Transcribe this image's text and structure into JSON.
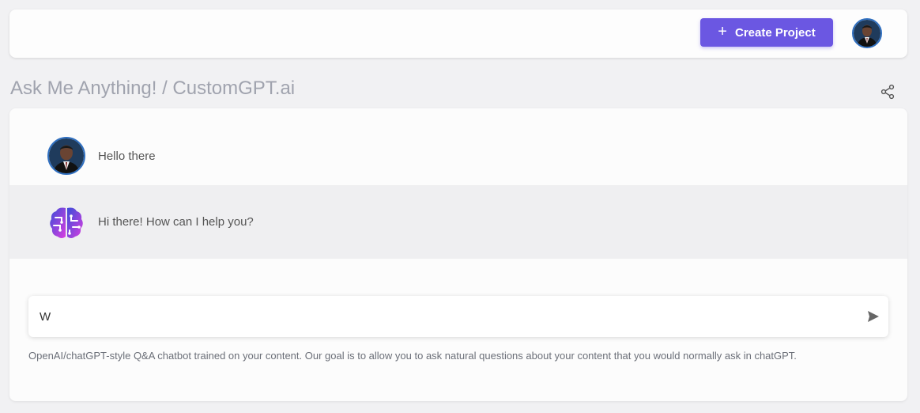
{
  "header": {
    "create_button_label": "Create Project",
    "user_avatar": "user-avatar-photo"
  },
  "page": {
    "title": "Ask Me Anything! / CustomGPT.ai"
  },
  "chat": {
    "messages": [
      {
        "role": "user",
        "text": "Hello there",
        "avatar": "user-avatar-photo"
      },
      {
        "role": "assistant",
        "text": "Hi there! How can I help you?",
        "avatar": "brain-icon"
      }
    ],
    "input_value": "W",
    "footnote": "OpenAI/chatGPT-style Q&A chatbot trained on your content. Our goal is to allow you to ask natural questions about your content that you would normally ask in chatGPT."
  },
  "icons": {
    "create": "plus-icon",
    "share": "share-icon",
    "send": "send-icon"
  },
  "colors": {
    "accent": "#6b57e2",
    "avatar_ring": "#2f6fc0",
    "brain_gradient_start": "#3a4dd8",
    "brain_gradient_end": "#d93ee0"
  }
}
